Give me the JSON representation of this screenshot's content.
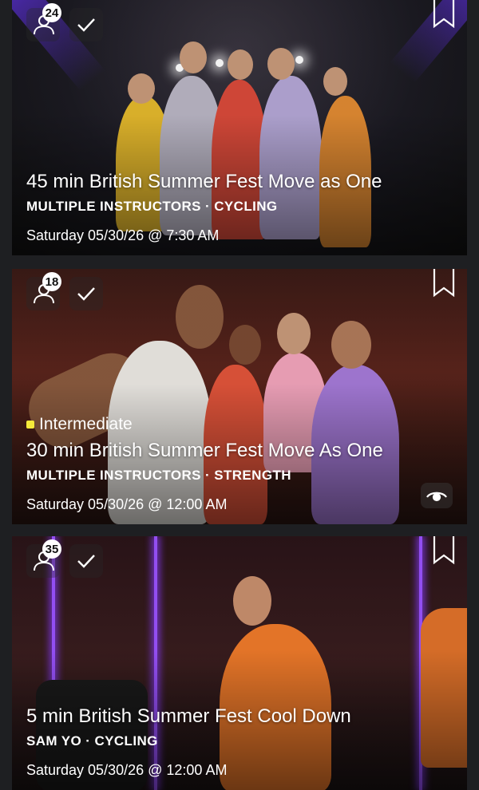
{
  "classes": [
    {
      "participants": "24",
      "title": "45 min British Summer Fest Move as One",
      "subtitle": "MULTIPLE INSTRUCTORS · CYCLING",
      "schedule": "Saturday 05/30/26 @ 7:30 AM",
      "level": ""
    },
    {
      "participants": "18",
      "level": "Intermediate",
      "title": "30 min British Summer Fest Move As One",
      "subtitle": "MULTIPLE INSTRUCTORS · STRENGTH",
      "schedule": "Saturday 05/30/26 @ 12:00 AM"
    },
    {
      "participants": "35",
      "title": "5 min British Summer Fest Cool Down",
      "subtitle": "SAM YO · CYCLING",
      "schedule": "Saturday 05/30/26 @ 12:00 AM",
      "level": ""
    }
  ],
  "icons": {
    "participants": "users-icon",
    "completed": "checkmark-icon",
    "bookmark": "bookmark-icon",
    "preview": "eye-icon"
  },
  "colors": {
    "level_marker": "#f5ea3a",
    "background": "#1e1f22"
  }
}
